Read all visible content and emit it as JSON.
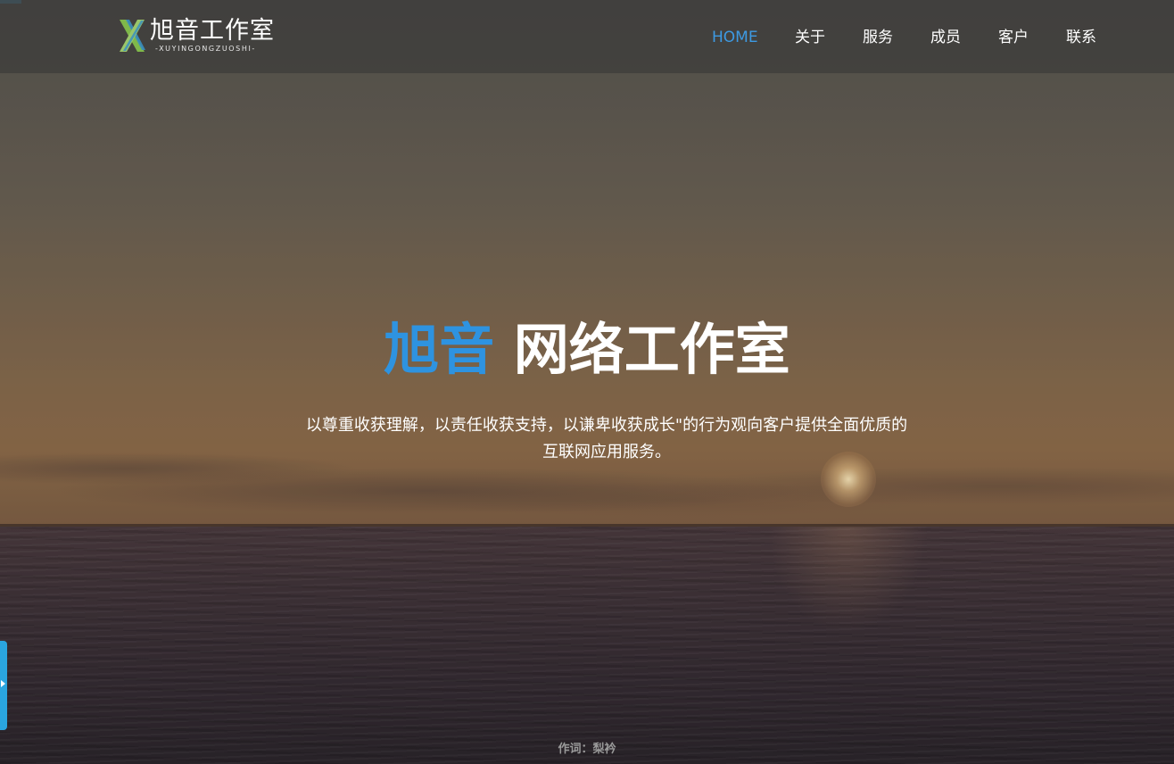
{
  "header": {
    "logo": {
      "title": "旭音工作室",
      "subtitle": "-XUYINGONGZUOSHI-",
      "mark_colors": [
        "#3a8fbf",
        "#7fb84a",
        "#9ac66a"
      ]
    },
    "nav": [
      {
        "label": "HOME",
        "active": true
      },
      {
        "label": "关于",
        "active": false
      },
      {
        "label": "服务",
        "active": false
      },
      {
        "label": "成员",
        "active": false
      },
      {
        "label": "客户",
        "active": false
      },
      {
        "label": "联系",
        "active": false
      }
    ]
  },
  "hero": {
    "title_accent": "旭音",
    "title_rest": "网络工作室",
    "description_line1": "以尊重收获理解，以责任收获支持，以谦卑收获成长\"的行为观向客户提供全面优质的",
    "description_line2": "互联网应用服务。",
    "background": "sunset-over-sea"
  },
  "footer_credit": "作词：梨衿",
  "colors": {
    "accent": "#2e93e0",
    "nav_active": "#3d9ae3",
    "side_tab": "#2aa5df"
  }
}
